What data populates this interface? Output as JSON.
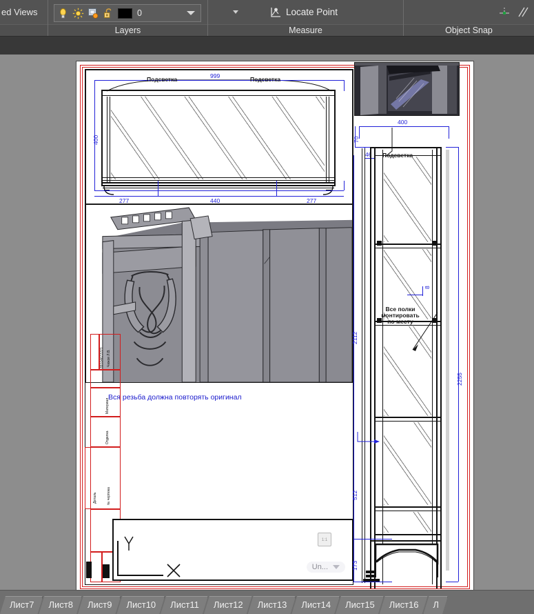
{
  "app": {
    "type": "cad-layout-editor"
  },
  "ribbon": {
    "panels": [
      {
        "title_visible": "",
        "label": "ed Views",
        "name": "named-views"
      },
      {
        "title": "Layers",
        "name": "layers"
      },
      {
        "title": "Measure",
        "name": "measure"
      },
      {
        "title": "Object Snap",
        "name": "object-snap"
      }
    ],
    "views_panel": {
      "label": "ed Views"
    },
    "layers_panel": {
      "title": "Layers",
      "current_layer": "0",
      "color_swatch": "#000000",
      "icons": [
        "lightbulb-on-icon",
        "sun-icon",
        "freeze-icon",
        "unlock-icon"
      ]
    },
    "measure_panel": {
      "title": "Measure",
      "locate_point_label": "Locate Point"
    },
    "osnap_panel": {
      "title": "Object Snap"
    }
  },
  "drawing": {
    "front_view": {
      "notes": [
        "Подсветка",
        "Подсветка"
      ],
      "dimensions": {
        "overall_width": "999",
        "height": "400",
        "seg_left": "277",
        "seg_center": "440",
        "seg_right": "277"
      }
    },
    "side_view": {
      "note_backlight": "Подсветка",
      "note_shelves": "Все полки монтировать по месту",
      "dimensions": {
        "depth": "400",
        "top_offset": "70",
        "small_offset": "46",
        "glass_thk": "8",
        "body_height": "2112",
        "total_height": "2255",
        "lower_section": "512",
        "base_height": "173"
      }
    },
    "general_note": "Вся резьба должна повторять оригинал",
    "titleblock": {
      "rows": [
        "Чижов Л.В.",
        "89104672221",
        "Материал",
        "Отделка",
        "№ чертежа",
        "Деталь"
      ]
    },
    "overlay_widget": {
      "dropdown_label": "Un...",
      "button_glyph": "1:1"
    }
  },
  "tabs": {
    "items": [
      {
        "label": "Лист7"
      },
      {
        "label": "Лист8"
      },
      {
        "label": "Лист9"
      },
      {
        "label": "Лист10"
      },
      {
        "label": "Лист11"
      },
      {
        "label": "Лист12"
      },
      {
        "label": "Лист13"
      },
      {
        "label": "Лист14"
      },
      {
        "label": "Лист15"
      },
      {
        "label": "Лист16"
      },
      {
        "label": "Л"
      }
    ]
  },
  "colors": {
    "ribbon_bg": "#535353",
    "canvas_bg": "#8d8d8d",
    "paper": "#ffffff",
    "dim_blue": "#2020d8",
    "frame_red": "#d21d1d",
    "tab_bg": "#7e7e7e"
  }
}
